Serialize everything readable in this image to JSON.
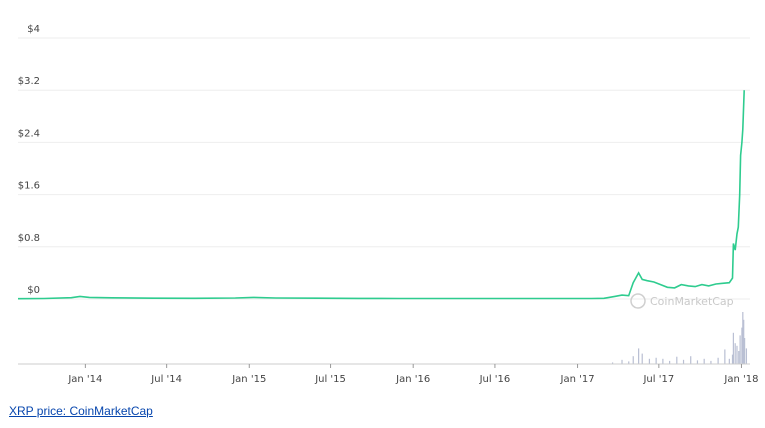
{
  "caption": "XRP price: CoinMarketCap",
  "watermark": "CoinMarketCap",
  "colors": {
    "line": "#2ecc8f",
    "volume": "#b9bfd3",
    "grid": "#eeeeee",
    "axis": "#cccccc",
    "link": "#0645ad"
  },
  "chart_data": {
    "type": "line",
    "title": "",
    "xlabel": "",
    "ylabel": "",
    "ylim": [
      0,
      4
    ],
    "xlim": [
      "2013-08-04",
      "2018-01-20"
    ],
    "y_ticks": [
      0,
      0.8,
      1.6,
      2.4,
      3.2,
      4
    ],
    "y_tick_labels": [
      "$0",
      "$0.8",
      "$1.6",
      "$2.4",
      "$3.2",
      "$4"
    ],
    "x_ticks": [
      "2014-01-01",
      "2014-07-01",
      "2015-01-01",
      "2015-07-01",
      "2016-01-01",
      "2016-07-01",
      "2017-01-01",
      "2017-07-01",
      "2018-01-01"
    ],
    "x_tick_labels": [
      "Jan '14",
      "Jul '14",
      "Jan '15",
      "Jul '15",
      "Jan '16",
      "Jul '16",
      "Jan '17",
      "Jul '17",
      "Jan '18"
    ],
    "grid": true,
    "series": [
      {
        "x": [
          "2013-08-04",
          "2013-10-01",
          "2013-12-01",
          "2013-12-20",
          "2014-01-10",
          "2014-03-01",
          "2014-06-01",
          "2014-09-01",
          "2014-12-01",
          "2015-01-10",
          "2015-03-01",
          "2015-06-01",
          "2015-09-01",
          "2015-12-01",
          "2016-03-01",
          "2016-06-01",
          "2016-09-01",
          "2016-12-01",
          "2017-02-01",
          "2017-03-01",
          "2017-03-25",
          "2017-04-10",
          "2017-04-25",
          "2017-05-05",
          "2017-05-17",
          "2017-05-25",
          "2017-06-05",
          "2017-06-20",
          "2017-07-05",
          "2017-07-20",
          "2017-08-05",
          "2017-08-20",
          "2017-09-05",
          "2017-09-20",
          "2017-10-05",
          "2017-10-20",
          "2017-11-05",
          "2017-11-20",
          "2017-12-05",
          "2017-12-12",
          "2017-12-14",
          "2017-12-18",
          "2017-12-22",
          "2017-12-25",
          "2017-12-28",
          "2017-12-30",
          "2018-01-02",
          "2018-01-04",
          "2018-01-07"
        ],
        "y": [
          0.005,
          0.008,
          0.02,
          0.04,
          0.025,
          0.018,
          0.012,
          0.01,
          0.015,
          0.025,
          0.015,
          0.012,
          0.009,
          0.007,
          0.007,
          0.008,
          0.007,
          0.007,
          0.007,
          0.01,
          0.04,
          0.06,
          0.05,
          0.25,
          0.4,
          0.3,
          0.28,
          0.26,
          0.22,
          0.18,
          0.17,
          0.22,
          0.2,
          0.19,
          0.22,
          0.2,
          0.23,
          0.24,
          0.25,
          0.32,
          0.85,
          0.75,
          1.0,
          1.1,
          1.6,
          2.2,
          2.4,
          2.6,
          3.2
        ]
      }
    ],
    "volume_series": {
      "x": [
        "2017-03-20",
        "2017-04-10",
        "2017-04-25",
        "2017-05-05",
        "2017-05-17",
        "2017-05-25",
        "2017-06-10",
        "2017-06-25",
        "2017-07-10",
        "2017-07-25",
        "2017-08-10",
        "2017-08-25",
        "2017-09-10",
        "2017-09-25",
        "2017-10-10",
        "2017-10-25",
        "2017-11-10",
        "2017-11-25",
        "2017-12-05",
        "2017-12-12",
        "2017-12-14",
        "2017-12-18",
        "2017-12-22",
        "2017-12-26",
        "2017-12-29",
        "2018-01-02",
        "2018-01-04",
        "2018-01-06",
        "2018-01-08",
        "2018-01-12"
      ],
      "relative": [
        0.03,
        0.08,
        0.05,
        0.15,
        0.3,
        0.2,
        0.1,
        0.12,
        0.1,
        0.06,
        0.14,
        0.08,
        0.15,
        0.07,
        0.1,
        0.06,
        0.12,
        0.28,
        0.1,
        0.18,
        0.6,
        0.4,
        0.35,
        0.25,
        0.55,
        0.7,
        1.0,
        0.85,
        0.5,
        0.3
      ]
    }
  }
}
